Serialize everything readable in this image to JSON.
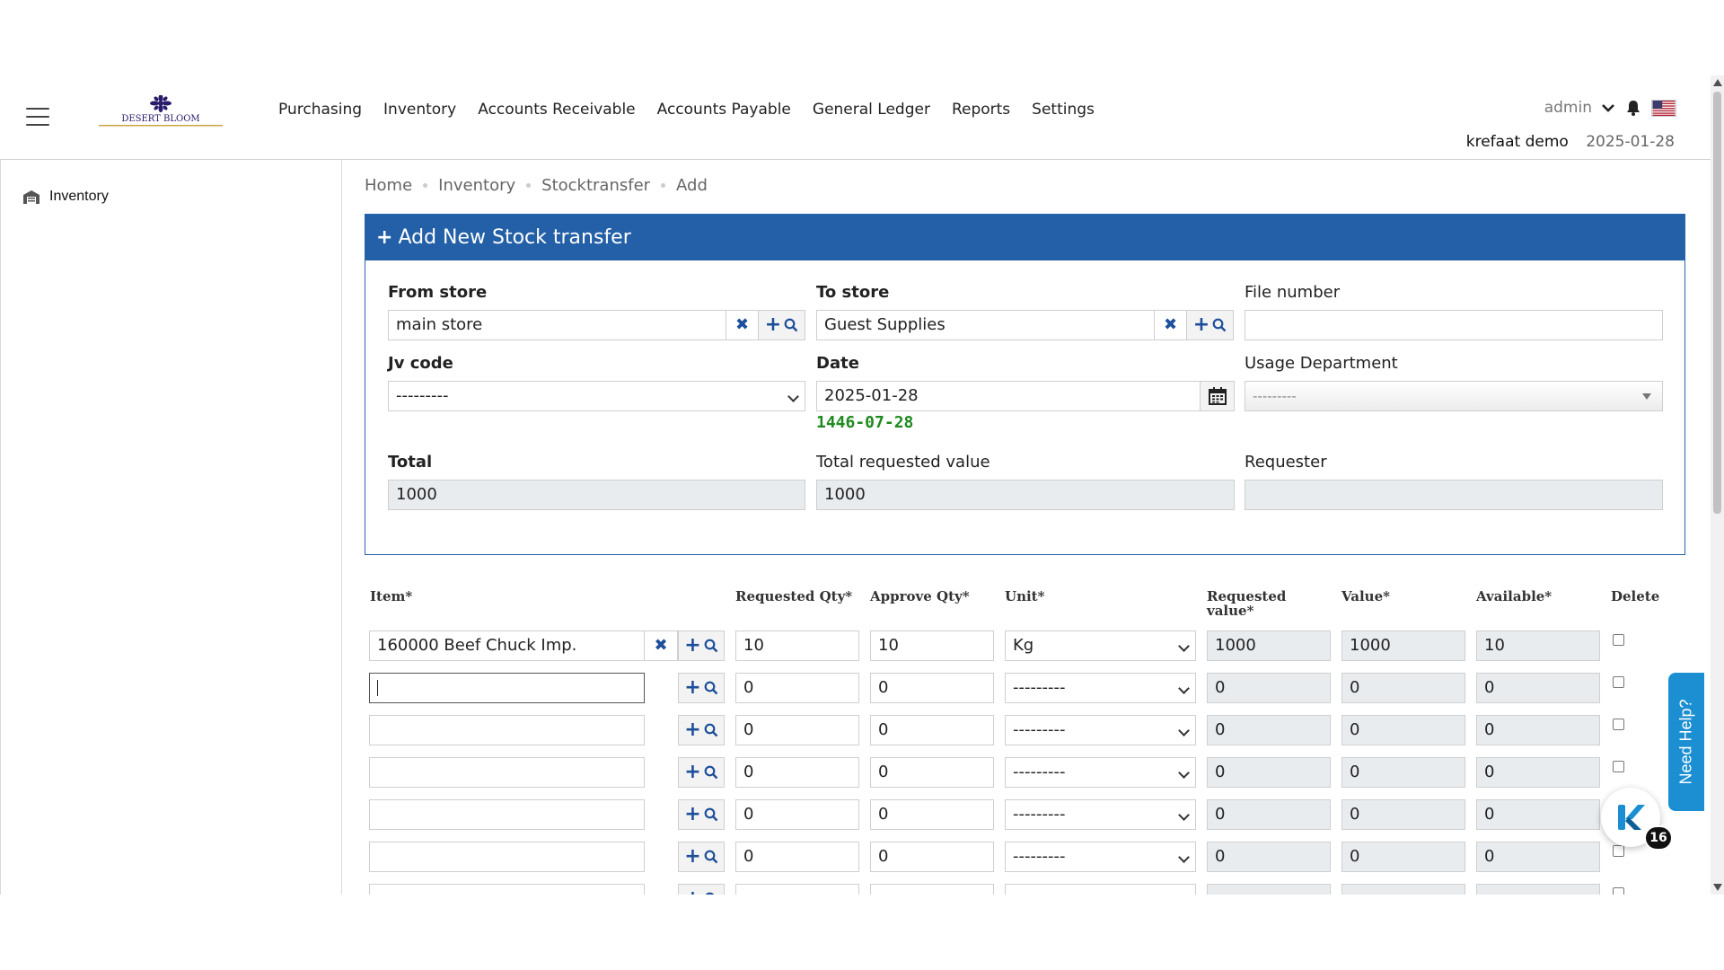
{
  "header": {
    "logo_text": "DESERT BLOOM",
    "nav": [
      "Purchasing",
      "Inventory",
      "Accounts Receivable",
      "Accounts Payable",
      "General Ledger",
      "Reports",
      "Settings"
    ],
    "user": "admin",
    "company": "krefaat demo",
    "date": "2025-01-28"
  },
  "sidebar": {
    "items": [
      {
        "label": "Inventory"
      }
    ]
  },
  "breadcrumb": [
    "Home",
    "Inventory",
    "Stocktransfer",
    "Add"
  ],
  "form": {
    "title": "Add New Stock transfer",
    "from_store": {
      "label": "From store",
      "value": "main store"
    },
    "to_store": {
      "label": "To store",
      "value": "Guest Supplies"
    },
    "file_number": {
      "label": "File number",
      "value": ""
    },
    "jv_code": {
      "label": "Jv code",
      "value": "---------"
    },
    "date": {
      "label": "Date",
      "value": "2025-01-28",
      "hijri": "1446-07-28"
    },
    "usage_department": {
      "label": "Usage Department",
      "value": "---------"
    },
    "total": {
      "label": "Total",
      "value": "1000"
    },
    "total_requested_value": {
      "label": "Total requested value",
      "value": "1000"
    },
    "requester": {
      "label": "Requester",
      "value": ""
    }
  },
  "items_table": {
    "columns": {
      "item": "Item*",
      "requested_qty": "Requested Qty*",
      "approve_qty": "Approve Qty*",
      "unit": "Unit*",
      "requested_value_1": "Requested",
      "requested_value_2": "value*",
      "value": "Value*",
      "available": "Available*",
      "delete": "Delete"
    },
    "rows": [
      {
        "item": "160000 Beef Chuck Imp.",
        "requested_qty": "10",
        "approve_qty": "10",
        "unit": "Kg",
        "requested_value": "1000",
        "value": "1000",
        "available": "10"
      },
      {
        "item": "",
        "requested_qty": "0",
        "approve_qty": "0",
        "unit": "---------",
        "requested_value": "0",
        "value": "0",
        "available": "0"
      },
      {
        "item": "",
        "requested_qty": "0",
        "approve_qty": "0",
        "unit": "---------",
        "requested_value": "0",
        "value": "0",
        "available": "0"
      },
      {
        "item": "",
        "requested_qty": "0",
        "approve_qty": "0",
        "unit": "---------",
        "requested_value": "0",
        "value": "0",
        "available": "0"
      },
      {
        "item": "",
        "requested_qty": "0",
        "approve_qty": "0",
        "unit": "---------",
        "requested_value": "0",
        "value": "0",
        "available": "0"
      },
      {
        "item": "",
        "requested_qty": "0",
        "approve_qty": "0",
        "unit": "---------",
        "requested_value": "0",
        "value": "0",
        "available": "0"
      }
    ]
  },
  "help": {
    "label": "Need Help?",
    "badge": "16"
  },
  "colors": {
    "accent": "#2460a7",
    "hijri": "#1d8a1d",
    "help": "#1b8fd2"
  },
  "icons": {
    "menu": "hamburger-icon",
    "bell": "bell-icon",
    "flag": "us-flag-icon",
    "clear": "close-icon",
    "lookup": "plus-search-icon",
    "calendar": "calendar-icon",
    "warehouse": "warehouse-icon"
  }
}
